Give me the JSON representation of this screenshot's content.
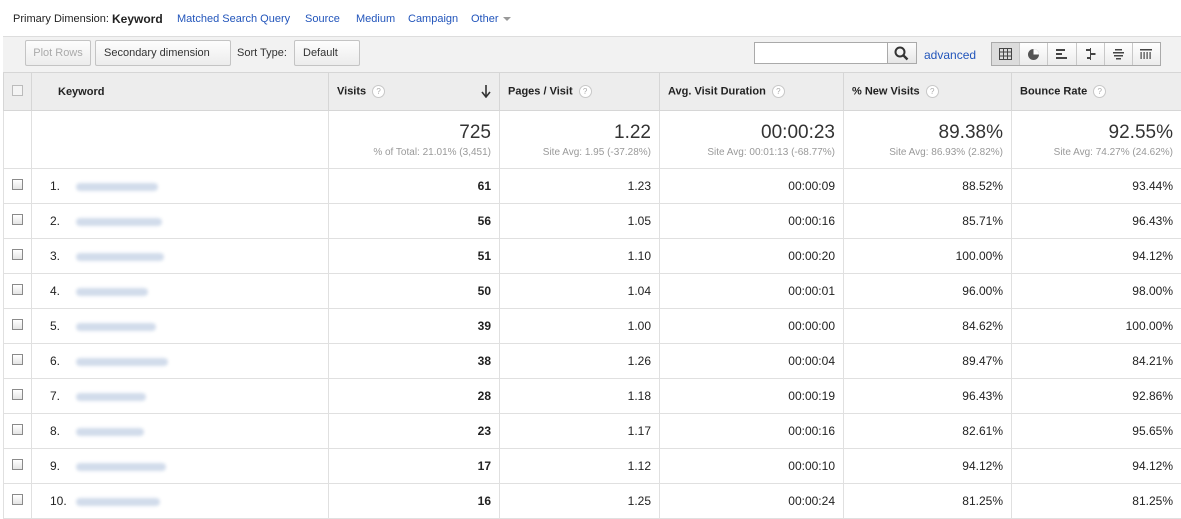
{
  "primary_dimension": {
    "label": "Primary Dimension:",
    "active": "Keyword",
    "links": [
      "Matched Search Query",
      "Source",
      "Medium",
      "Campaign",
      "Other"
    ]
  },
  "toolbar": {
    "plot_rows": "Plot Rows",
    "secondary_dimension": "Secondary dimension",
    "sort_type_label": "Sort Type:",
    "sort_type_value": "Default",
    "search_value": "",
    "advanced": "advanced",
    "view_icons": [
      "table-view-icon",
      "pie-view-icon",
      "performance-view-icon",
      "comparison-view-icon",
      "term-cloud-view-icon",
      "pivot-view-icon"
    ]
  },
  "table": {
    "headers": {
      "keyword": "Keyword",
      "visits": "Visits",
      "pages_visit": "Pages / Visit",
      "avg_duration": "Avg. Visit Duration",
      "new_visits": "% New Visits",
      "bounce_rate": "Bounce Rate"
    },
    "totals": {
      "visits": "725",
      "visits_sub": "% of Total: 21.01% (3,451)",
      "pages_visit": "1.22",
      "pages_visit_sub": "Site Avg: 1.95 (-37.28%)",
      "avg_duration": "00:00:23",
      "avg_duration_sub": "Site Avg: 00:01:13 (-68.77%)",
      "new_visits": "89.38%",
      "new_visits_sub": "Site Avg: 86.93% (2.82%)",
      "bounce_rate": "92.55%",
      "bounce_rate_sub": "Site Avg: 74.27% (24.62%)"
    },
    "rows": [
      {
        "n": "1.",
        "visits": "61",
        "pages": "1.23",
        "duration": "00:00:09",
        "new": "88.52%",
        "bounce": "93.44%"
      },
      {
        "n": "2.",
        "visits": "56",
        "pages": "1.05",
        "duration": "00:00:16",
        "new": "85.71%",
        "bounce": "96.43%"
      },
      {
        "n": "3.",
        "visits": "51",
        "pages": "1.10",
        "duration": "00:00:20",
        "new": "100.00%",
        "bounce": "94.12%"
      },
      {
        "n": "4.",
        "visits": "50",
        "pages": "1.04",
        "duration": "00:00:01",
        "new": "96.00%",
        "bounce": "98.00%"
      },
      {
        "n": "5.",
        "visits": "39",
        "pages": "1.00",
        "duration": "00:00:00",
        "new": "84.62%",
        "bounce": "100.00%"
      },
      {
        "n": "6.",
        "visits": "38",
        "pages": "1.26",
        "duration": "00:00:04",
        "new": "89.47%",
        "bounce": "84.21%"
      },
      {
        "n": "7.",
        "visits": "28",
        "pages": "1.18",
        "duration": "00:00:19",
        "new": "96.43%",
        "bounce": "92.86%"
      },
      {
        "n": "8.",
        "visits": "23",
        "pages": "1.17",
        "duration": "00:00:16",
        "new": "82.61%",
        "bounce": "95.65%"
      },
      {
        "n": "9.",
        "visits": "17",
        "pages": "1.12",
        "duration": "00:00:10",
        "new": "94.12%",
        "bounce": "94.12%"
      },
      {
        "n": "10.",
        "visits": "16",
        "pages": "1.25",
        "duration": "00:00:24",
        "new": "81.25%",
        "bounce": "81.25%"
      }
    ]
  },
  "colors": {
    "link": "#2255bb",
    "header_bg": "#ededed",
    "toolbar_bg": "#f2f2f2"
  }
}
